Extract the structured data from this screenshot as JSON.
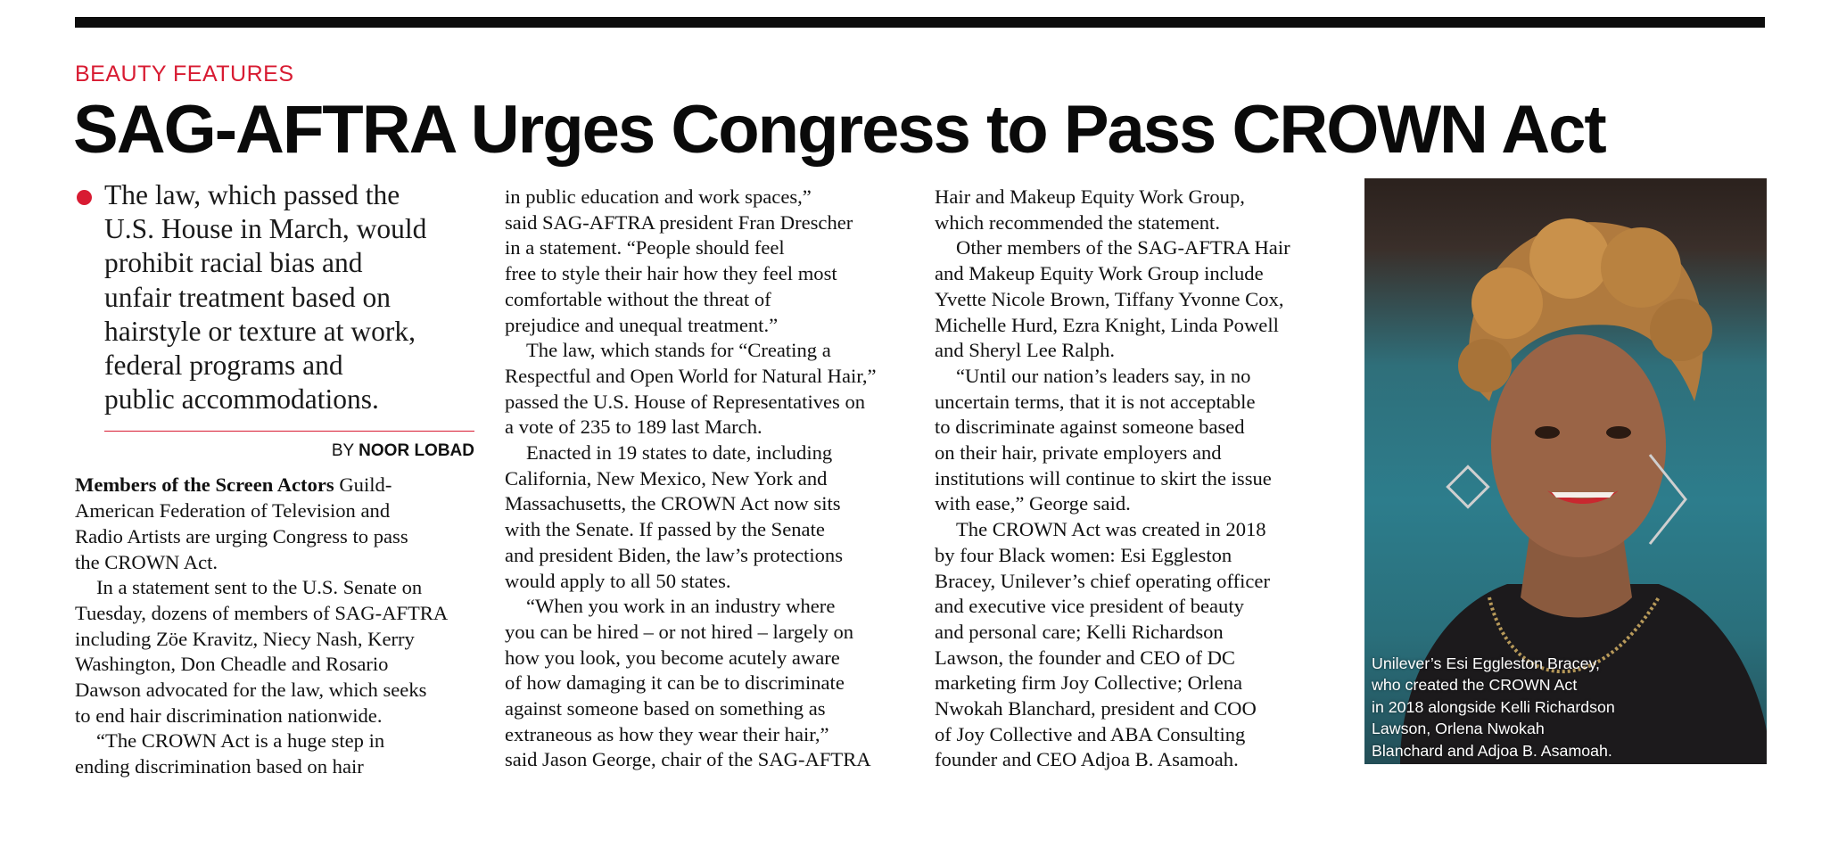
{
  "section": "BEAUTY FEATURES",
  "headline": "SAG-AFTRA Urges Congress to Pass CROWN Act",
  "deck": [
    "The law, which passed the",
    "U.S. House in March, would",
    "prohibit racial bias and",
    "unfair treatment based on",
    "hairstyle or texture at work,",
    "federal programs and",
    "public accommodations."
  ],
  "byline": {
    "prefix": "BY",
    "name": "NOOR LOBAD"
  },
  "col1": {
    "lead": "Members of the Screen Actors",
    "first_para_rest": " Guild-",
    "lines": [
      "American Federation of Television and",
      "Radio Artists are urging Congress to pass",
      "the CROWN Act."
    ],
    "para2": [
      "In a statement sent to the U.S. Senate on",
      "Tuesday, dozens of members of SAG-AFTRA",
      "including Zöe Kravitz, Niecy Nash, Kerry",
      "Washington, Don Cheadle and Rosario",
      "Dawson advocated for the law, which seeks",
      "to end hair discrimination nationwide."
    ],
    "para3": [
      "“The CROWN Act is a huge step in",
      "ending discrimination based on hair"
    ]
  },
  "col2": {
    "para1": [
      "in public education and work spaces,”",
      "said SAG-AFTRA president Fran Drescher",
      "in a statement. “People should feel",
      "free to style their hair how they feel most",
      "comfortable without the threat of",
      "prejudice and unequal treatment.”"
    ],
    "para2": [
      "The law, which stands for “Creating a",
      "Respectful and Open World for Natural Hair,”",
      "passed the U.S. House of Representatives on",
      "a vote of 235 to 189 last March."
    ],
    "para3": [
      "Enacted in 19 states to date, including",
      "California, New Mexico, New York and",
      "Massachusetts, the CROWN Act now sits",
      "with the Senate. If passed by the Senate",
      "and president Biden, the law’s protections",
      "would apply to all 50 states."
    ],
    "para4": [
      "“When you work in an industry where",
      "you can be hired – or not hired – largely on",
      "how you look, you become acutely aware",
      "of how damaging it can be to discriminate",
      "against someone based on something as",
      "extraneous as how they wear their hair,”",
      "said Jason George, chair of the SAG-AFTRA"
    ]
  },
  "col3": {
    "para1": [
      "Hair and Makeup Equity Work Group,",
      "which recommended the statement."
    ],
    "para2": [
      "Other members of the SAG-AFTRA Hair",
      "and Makeup Equity Work Group include",
      "Yvette Nicole Brown, Tiffany Yvonne Cox,",
      "Michelle Hurd, Ezra Knight, Linda Powell",
      "and Sheryl Lee Ralph."
    ],
    "para3": [
      "“Until our nation’s leaders say, in no",
      "uncertain terms, that it is not acceptable",
      "to discriminate against someone based",
      "on their hair, private employers and",
      "institutions will continue to skirt the issue",
      "with ease,” George said."
    ],
    "para4": [
      "The CROWN Act was created in 2018",
      "by four Black women: Esi Eggleston",
      "Bracey, Unilever’s chief operating officer",
      "and executive vice president of beauty",
      "and personal care; Kelli Richardson",
      "Lawson, the founder and CEO of DC",
      "marketing firm Joy Collective; Orlena",
      "Nwokah Blanchard, president and COO",
      "of Joy Collective and ABA Consulting",
      "founder and CEO Adjoa B. Asamoah."
    ]
  },
  "caption": [
    "Unilever’s Esi Eggleston Bracey,",
    "who created the CROWN Act",
    "in 2018 alongside Kelli Richardson",
    "Lawson, Orlena Nwokah",
    "Blanchard and Adjoa B. Asamoah."
  ],
  "colors": {
    "accent": "#d81b32",
    "rule": "#0d0d0d",
    "text": "#111111"
  }
}
